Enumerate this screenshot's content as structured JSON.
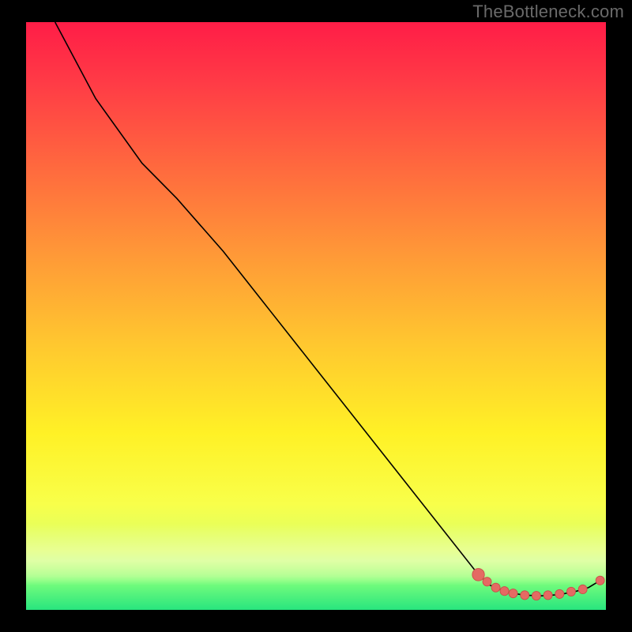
{
  "watermark": "TheBottleneck.com",
  "colors": {
    "curve": "#000000",
    "marker_fill": "#e46a63",
    "marker_stroke": "#c94f48"
  },
  "chart_data": {
    "type": "line",
    "title": "",
    "xlabel": "",
    "ylabel": "",
    "xlim": [
      0,
      100
    ],
    "ylim": [
      0,
      100
    ],
    "curve": [
      {
        "x": 5,
        "y": 100
      },
      {
        "x": 12,
        "y": 87
      },
      {
        "x": 20,
        "y": 76
      },
      {
        "x": 26,
        "y": 70
      },
      {
        "x": 34,
        "y": 61
      },
      {
        "x": 42,
        "y": 51
      },
      {
        "x": 50,
        "y": 41
      },
      {
        "x": 58,
        "y": 31
      },
      {
        "x": 66,
        "y": 21
      },
      {
        "x": 74,
        "y": 11
      },
      {
        "x": 78,
        "y": 6
      },
      {
        "x": 80,
        "y": 4.2
      },
      {
        "x": 83,
        "y": 3.0
      },
      {
        "x": 86,
        "y": 2.5
      },
      {
        "x": 89,
        "y": 2.4
      },
      {
        "x": 92,
        "y": 2.6
      },
      {
        "x": 95,
        "y": 3.2
      },
      {
        "x": 97,
        "y": 3.8
      },
      {
        "x": 99,
        "y": 5.0
      }
    ],
    "markers": [
      {
        "x": 78.0,
        "y": 6.0
      },
      {
        "x": 79.5,
        "y": 4.8
      },
      {
        "x": 81.0,
        "y": 3.8
      },
      {
        "x": 82.5,
        "y": 3.2
      },
      {
        "x": 84.0,
        "y": 2.8
      },
      {
        "x": 86.0,
        "y": 2.5
      },
      {
        "x": 88.0,
        "y": 2.4
      },
      {
        "x": 90.0,
        "y": 2.5
      },
      {
        "x": 92.0,
        "y": 2.7
      },
      {
        "x": 94.0,
        "y": 3.1
      },
      {
        "x": 96.0,
        "y": 3.5
      },
      {
        "x": 99.0,
        "y": 5.0
      }
    ],
    "marker_radius_first": 1.05,
    "marker_radius": 0.75
  }
}
